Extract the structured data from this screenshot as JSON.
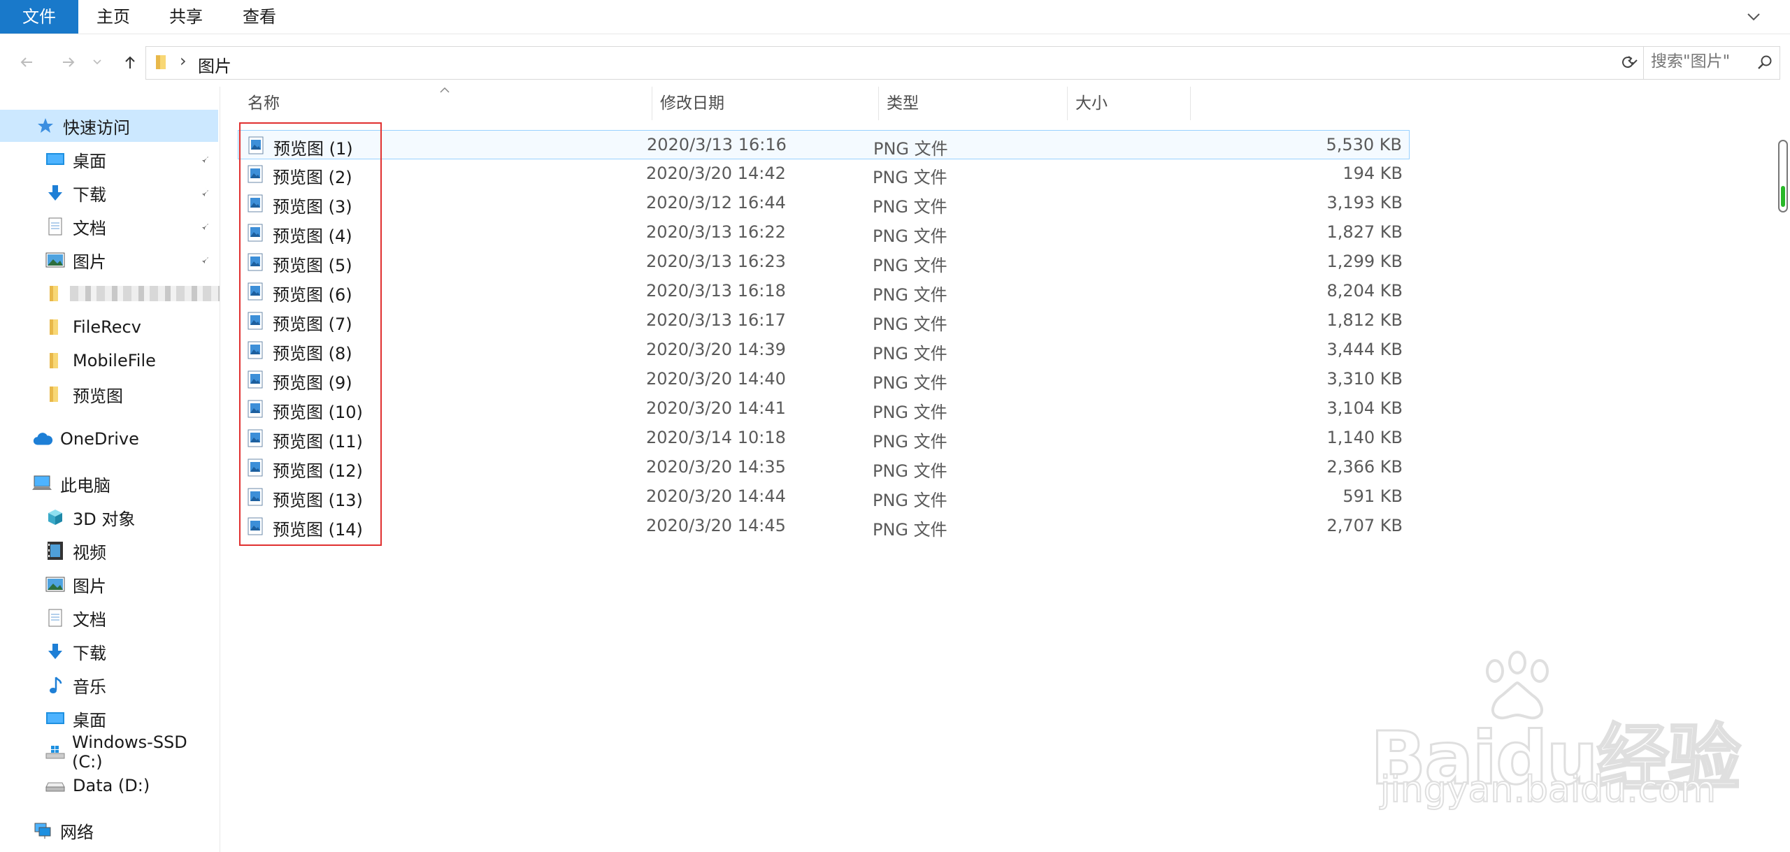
{
  "ribbon": {
    "tabs": [
      "文件",
      "主页",
      "共享",
      "查看"
    ]
  },
  "address": {
    "path": "图片",
    "search_placeholder": "搜索\"图片\""
  },
  "sidebar": {
    "quick_access": "快速访问",
    "quick_items": [
      {
        "label": "桌面",
        "icon": "desktop-icon",
        "pinned": true
      },
      {
        "label": "下载",
        "icon": "download-icon",
        "pinned": true
      },
      {
        "label": "文档",
        "icon": "document-icon",
        "pinned": true
      },
      {
        "label": "图片",
        "icon": "pictures-icon",
        "pinned": true
      },
      {
        "label": "",
        "icon": "folder-icon",
        "pinned": false
      },
      {
        "label": "FileRecv",
        "icon": "folder-icon",
        "pinned": false
      },
      {
        "label": "MobileFile",
        "icon": "folder-icon",
        "pinned": false
      },
      {
        "label": "预览图",
        "icon": "folder-icon",
        "pinned": false
      }
    ],
    "onedrive": "OneDrive",
    "this_pc": "此电脑",
    "pc_items": [
      {
        "label": "3D 对象",
        "icon": "3d-objects-icon"
      },
      {
        "label": "视频",
        "icon": "video-icon"
      },
      {
        "label": "图片",
        "icon": "pictures-icon"
      },
      {
        "label": "文档",
        "icon": "document-icon"
      },
      {
        "label": "下载",
        "icon": "download-icon"
      },
      {
        "label": "音乐",
        "icon": "music-icon"
      },
      {
        "label": "桌面",
        "icon": "desktop-icon"
      },
      {
        "label": "Windows-SSD (C:)",
        "icon": "windows-drive-icon"
      },
      {
        "label": "Data (D:)",
        "icon": "drive-icon"
      }
    ],
    "network": "网络"
  },
  "columns": {
    "name": "名称",
    "date": "修改日期",
    "type": "类型",
    "size": "大小"
  },
  "files": [
    {
      "name": "预览图 (1)",
      "date": "2020/3/13 16:16",
      "type": "PNG 文件",
      "size": "5,530 KB"
    },
    {
      "name": "预览图 (2)",
      "date": "2020/3/20 14:42",
      "type": "PNG 文件",
      "size": "194 KB"
    },
    {
      "name": "预览图 (3)",
      "date": "2020/3/12 16:44",
      "type": "PNG 文件",
      "size": "3,193 KB"
    },
    {
      "name": "预览图 (4)",
      "date": "2020/3/13 16:22",
      "type": "PNG 文件",
      "size": "1,827 KB"
    },
    {
      "name": "预览图 (5)",
      "date": "2020/3/13 16:23",
      "type": "PNG 文件",
      "size": "1,299 KB"
    },
    {
      "name": "预览图 (6)",
      "date": "2020/3/13 16:18",
      "type": "PNG 文件",
      "size": "8,204 KB"
    },
    {
      "name": "预览图 (7)",
      "date": "2020/3/13 16:17",
      "type": "PNG 文件",
      "size": "1,812 KB"
    },
    {
      "name": "预览图 (8)",
      "date": "2020/3/20 14:39",
      "type": "PNG 文件",
      "size": "3,444 KB"
    },
    {
      "name": "预览图 (9)",
      "date": "2020/3/20 14:40",
      "type": "PNG 文件",
      "size": "3,310 KB"
    },
    {
      "name": "预览图 (10)",
      "date": "2020/3/20 14:41",
      "type": "PNG 文件",
      "size": "3,104 KB"
    },
    {
      "name": "预览图 (11)",
      "date": "2020/3/14 10:18",
      "type": "PNG 文件",
      "size": "1,140 KB"
    },
    {
      "name": "预览图 (12)",
      "date": "2020/3/20 14:35",
      "type": "PNG 文件",
      "size": "2,366 KB"
    },
    {
      "name": "预览图 (13)",
      "date": "2020/3/20 14:44",
      "type": "PNG 文件",
      "size": "591 KB"
    },
    {
      "name": "预览图 (14)",
      "date": "2020/3/20 14:45",
      "type": "PNG 文件",
      "size": "2,707 KB"
    }
  ],
  "watermark": {
    "brand": "Baidu经验",
    "url": "jingyan.baidu.com"
  },
  "colors": {
    "accent": "#1979ca",
    "selection": "#cce8ff",
    "highlight_box": "#e03030"
  }
}
